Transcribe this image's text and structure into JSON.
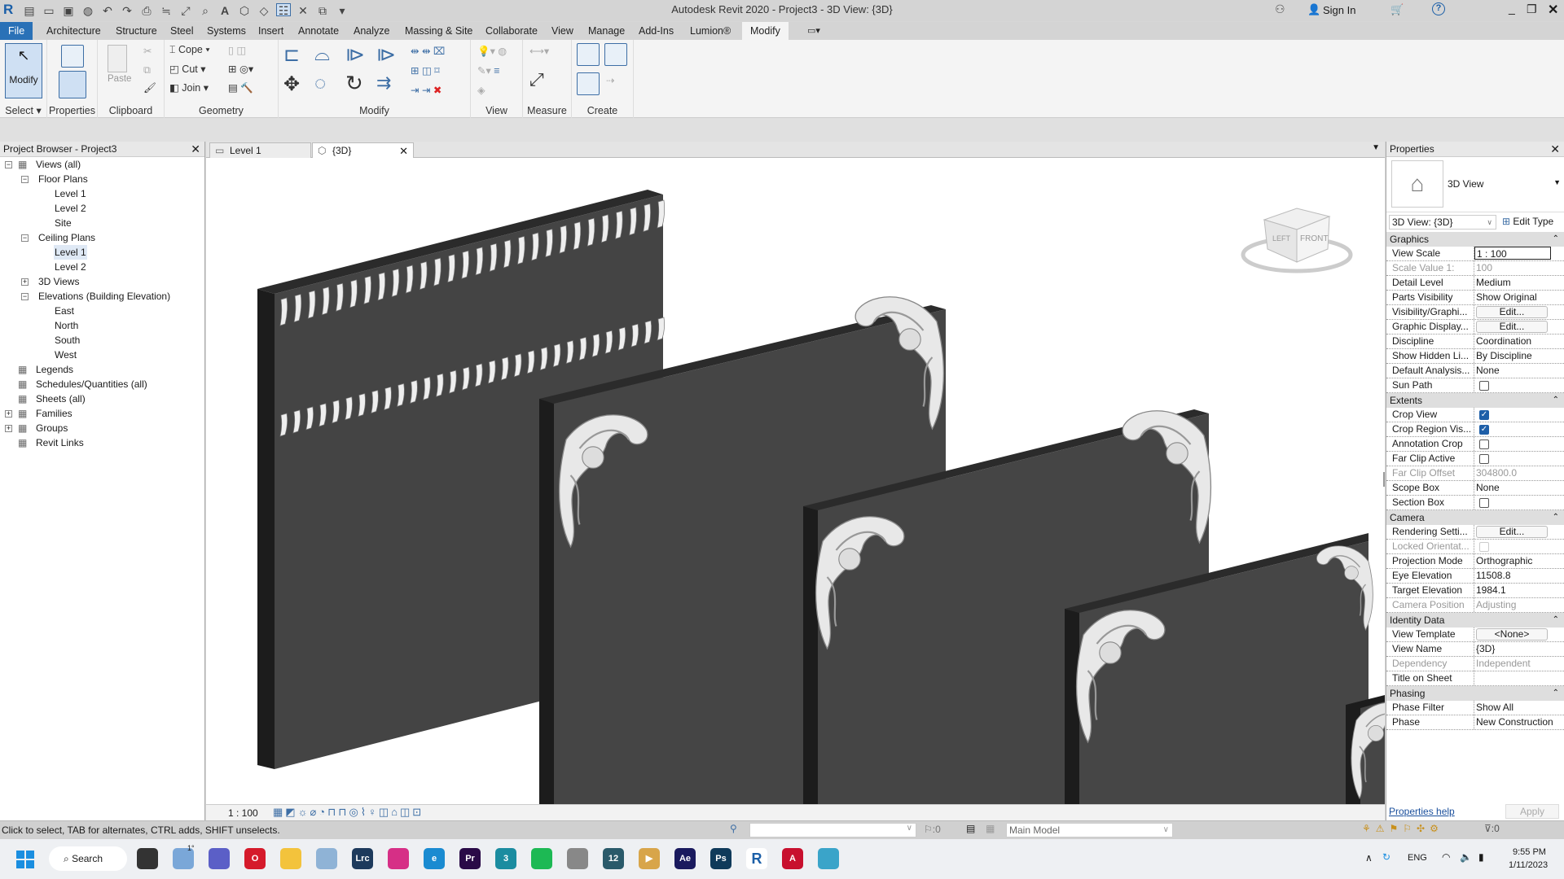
{
  "app": {
    "title": "Autodesk Revit 2020 - Project3 - 3D View: {3D}",
    "sign_in": "Sign In"
  },
  "ribbon": {
    "tabs": [
      "File",
      "Architecture",
      "Structure",
      "Steel",
      "Systems",
      "Insert",
      "Annotate",
      "Analyze",
      "Massing & Site",
      "Collaborate",
      "View",
      "Manage",
      "Add-Ins",
      "Lumion®",
      "Modify"
    ],
    "active_tab": "Modify",
    "panels": {
      "select": "Select ▾",
      "properties": "Properties",
      "clipboard": "Clipboard",
      "geometry": "Geometry",
      "modify": "Modify",
      "view": "View",
      "measure": "Measure",
      "create": "Create"
    },
    "buttons": {
      "modify": "Modify",
      "paste": "Paste",
      "cope": "Cope",
      "cut": "Cut",
      "join": "Join"
    }
  },
  "project_browser": {
    "title": "Project Browser - Project3",
    "tree": [
      {
        "label": "Views (all)",
        "level": 0,
        "toggle": "−",
        "icon": "views-icon"
      },
      {
        "label": "Floor Plans",
        "level": 1,
        "toggle": "−"
      },
      {
        "label": "Level 1",
        "level": 2
      },
      {
        "label": "Level 2",
        "level": 2
      },
      {
        "label": "Site",
        "level": 2
      },
      {
        "label": "Ceiling Plans",
        "level": 1,
        "toggle": "−"
      },
      {
        "label": "Level 1",
        "level": 2,
        "selected": true
      },
      {
        "label": "Level 2",
        "level": 2
      },
      {
        "label": "3D Views",
        "level": 1,
        "toggle": "+"
      },
      {
        "label": "Elevations (Building Elevation)",
        "level": 1,
        "toggle": "−"
      },
      {
        "label": "East",
        "level": 2
      },
      {
        "label": "North",
        "level": 2
      },
      {
        "label": "South",
        "level": 2
      },
      {
        "label": "West",
        "level": 2
      },
      {
        "label": "Legends",
        "level": 0,
        "icon": "legends-icon"
      },
      {
        "label": "Schedules/Quantities (all)",
        "level": 0,
        "icon": "schedules-icon"
      },
      {
        "label": "Sheets (all)",
        "level": 0,
        "icon": "sheets-icon"
      },
      {
        "label": "Families",
        "level": 0,
        "toggle": "+",
        "icon": "families-icon"
      },
      {
        "label": "Groups",
        "level": 0,
        "toggle": "+",
        "icon": "groups-icon"
      },
      {
        "label": "Revit Links",
        "level": 0,
        "icon": "links-icon"
      }
    ]
  },
  "view_tabs": [
    {
      "label": "Level 1",
      "active": false
    },
    {
      "label": "{3D}",
      "active": true
    }
  ],
  "viewcube": {
    "left": "LEFT",
    "front": "FRONT"
  },
  "view_control": {
    "scale": "1 : 100"
  },
  "properties": {
    "title": "Properties",
    "type_name": "3D View",
    "selector": "3D View: {3D}",
    "edit_type": "Edit Type",
    "sections": [
      {
        "name": "Graphics",
        "rows": [
          {
            "k": "View Scale",
            "v": "1 : 100",
            "kind": "input"
          },
          {
            "k": "Scale Value    1:",
            "v": "100",
            "dim": true
          },
          {
            "k": "Detail Level",
            "v": "Medium"
          },
          {
            "k": "Parts Visibility",
            "v": "Show Original"
          },
          {
            "k": "Visibility/Graphi...",
            "v": "Edit...",
            "kind": "button"
          },
          {
            "k": "Graphic Display...",
            "v": "Edit...",
            "kind": "button"
          },
          {
            "k": "Discipline",
            "v": "Coordination"
          },
          {
            "k": "Show Hidden Li...",
            "v": "By Discipline"
          },
          {
            "k": "Default Analysis...",
            "v": "None"
          },
          {
            "k": "Sun Path",
            "kind": "checkbox",
            "checked": false
          }
        ]
      },
      {
        "name": "Extents",
        "rows": [
          {
            "k": "Crop View",
            "kind": "checkbox",
            "checked": true
          },
          {
            "k": "Crop Region Vis...",
            "kind": "checkbox",
            "checked": true
          },
          {
            "k": "Annotation Crop",
            "kind": "checkbox",
            "checked": false
          },
          {
            "k": "Far Clip Active",
            "kind": "checkbox",
            "checked": false
          },
          {
            "k": "Far Clip Offset",
            "v": "304800.0",
            "dim": true
          },
          {
            "k": "Scope Box",
            "v": "None"
          },
          {
            "k": "Section Box",
            "kind": "checkbox",
            "checked": false
          }
        ]
      },
      {
        "name": "Camera",
        "rows": [
          {
            "k": "Rendering Setti...",
            "v": "Edit...",
            "kind": "button"
          },
          {
            "k": "Locked Orientat...",
            "kind": "checkbox",
            "checked": false,
            "dim": true
          },
          {
            "k": "Projection Mode",
            "v": "Orthographic"
          },
          {
            "k": "Eye Elevation",
            "v": "11508.8"
          },
          {
            "k": "Target Elevation",
            "v": "1984.1"
          },
          {
            "k": "Camera Position",
            "v": "Adjusting",
            "dim": true
          }
        ]
      },
      {
        "name": "Identity Data",
        "rows": [
          {
            "k": "View Template",
            "v": "<None>",
            "kind": "button"
          },
          {
            "k": "View Name",
            "v": "{3D}"
          },
          {
            "k": "Dependency",
            "v": "Independent",
            "dim": true
          },
          {
            "k": "Title on Sheet",
            "v": ""
          }
        ]
      },
      {
        "name": "Phasing",
        "rows": [
          {
            "k": "Phase Filter",
            "v": "Show All"
          },
          {
            "k": "Phase",
            "v": "New Construction"
          }
        ]
      }
    ],
    "help": "Properties help",
    "apply": "Apply"
  },
  "status": {
    "hint": "Click to select, TAB for alternates, CTRL adds, SHIFT unselects.",
    "selection_count": ":0",
    "model": "Main Model",
    "filter_count": ":0"
  },
  "taskbar": {
    "search": "Search",
    "weather": "1°",
    "lang": "ENG",
    "time": "9:55 PM",
    "date": "1/11/2023",
    "apps": [
      {
        "name": "task-view",
        "label": "",
        "color": "#333"
      },
      {
        "name": "weather",
        "label": "",
        "color": "#7aa7d8"
      },
      {
        "name": "teams",
        "label": "",
        "color": "#5b5fc7"
      },
      {
        "name": "opera",
        "label": "O",
        "color": "#d51a2b"
      },
      {
        "name": "explorer",
        "label": "",
        "color": "#f3c33c"
      },
      {
        "name": "monitor",
        "label": "",
        "color": "#8fb3d6"
      },
      {
        "name": "lightroom",
        "label": "Lrc",
        "color": "#1d3a5c"
      },
      {
        "name": "instagram",
        "label": "",
        "color": "#d62f86"
      },
      {
        "name": "edge",
        "label": "e",
        "color": "#1a8bd1"
      },
      {
        "name": "premiere",
        "label": "Pr",
        "color": "#2a0a47"
      },
      {
        "name": "3dsmax",
        "label": "3",
        "color": "#1b8ca0"
      },
      {
        "name": "spotify",
        "label": "",
        "color": "#1db954"
      },
      {
        "name": "app-gray",
        "label": "",
        "color": "#888"
      },
      {
        "name": "app-12",
        "label": "12",
        "color": "#2a5a6a"
      },
      {
        "name": "app-player",
        "label": "▶",
        "color": "#d8a54a"
      },
      {
        "name": "aftereffects",
        "label": "Ae",
        "color": "#1a1a5e"
      },
      {
        "name": "photoshop",
        "label": "Ps",
        "color": "#0f3a5a"
      },
      {
        "name": "revit",
        "label": "R",
        "color": "#1b5fa8"
      },
      {
        "name": "autocad",
        "label": "A",
        "color": "#c8102e"
      },
      {
        "name": "app-globe",
        "label": "",
        "color": "#3aa4c9"
      }
    ]
  }
}
